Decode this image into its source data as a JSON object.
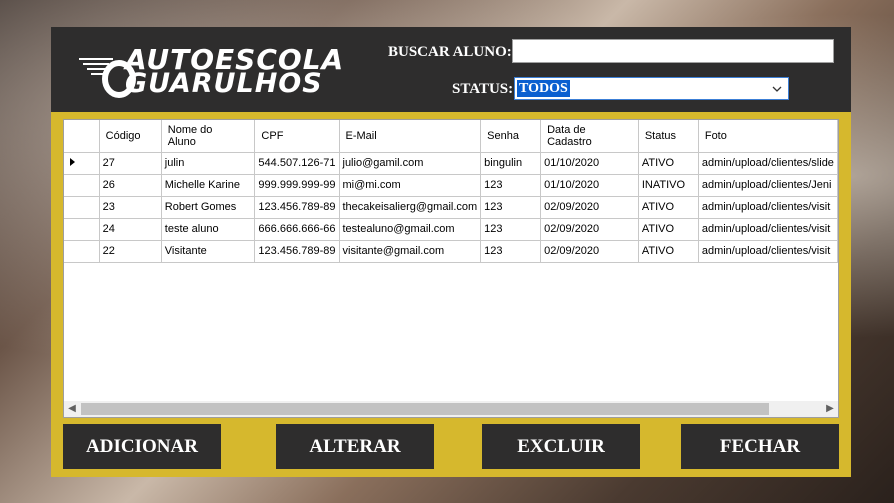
{
  "header": {
    "logo_line1": "AUTOESCOLA",
    "logo_line2": "GUARULHOS",
    "search_label": "BUSCAR ALUNO:",
    "search_value": "",
    "status_label": "STATUS:",
    "status_value": "TODOS"
  },
  "grid": {
    "columns": [
      "Código",
      "Nome do\nAluno",
      "CPF",
      "E-Mail",
      "Senha",
      "Data de\nCadastro",
      "Status",
      "Foto"
    ],
    "rows": [
      [
        "27",
        "julin",
        "544.507.126-71",
        "julio@gamil.com",
        "bingulin",
        "01/10/2020",
        "ATIVO",
        "admin/upload/clientes/slide"
      ],
      [
        "26",
        "Michelle Karine",
        "999.999.999-99",
        "mi@mi.com",
        "123",
        "01/10/2020",
        "INATIVO",
        "admin/upload/clientes/Jeni"
      ],
      [
        "23",
        "Robert Gomes",
        "123.456.789-89",
        "thecakeisalierg@gmail.com",
        "123",
        "02/09/2020",
        "ATIVO",
        "admin/upload/clientes/visit"
      ],
      [
        "24",
        "teste aluno",
        "666.666.666-66",
        "testealuno@gmail.com",
        "123",
        "02/09/2020",
        "ATIVO",
        "admin/upload/clientes/visit"
      ],
      [
        "22",
        "Visitante",
        "123.456.789-89",
        "visitante@gmail.com",
        "123",
        "02/09/2020",
        "ATIVO",
        "admin/upload/clientes/visit"
      ]
    ],
    "selected_row": 0
  },
  "buttons": {
    "add": "ADICIONAR",
    "alter": "ALTERAR",
    "delete": "EXCLUIR",
    "close": "FECHAR"
  },
  "colors": {
    "accent": "#d6b82d",
    "dark": "#2e2d2d",
    "selection": "#0a5fd0"
  }
}
